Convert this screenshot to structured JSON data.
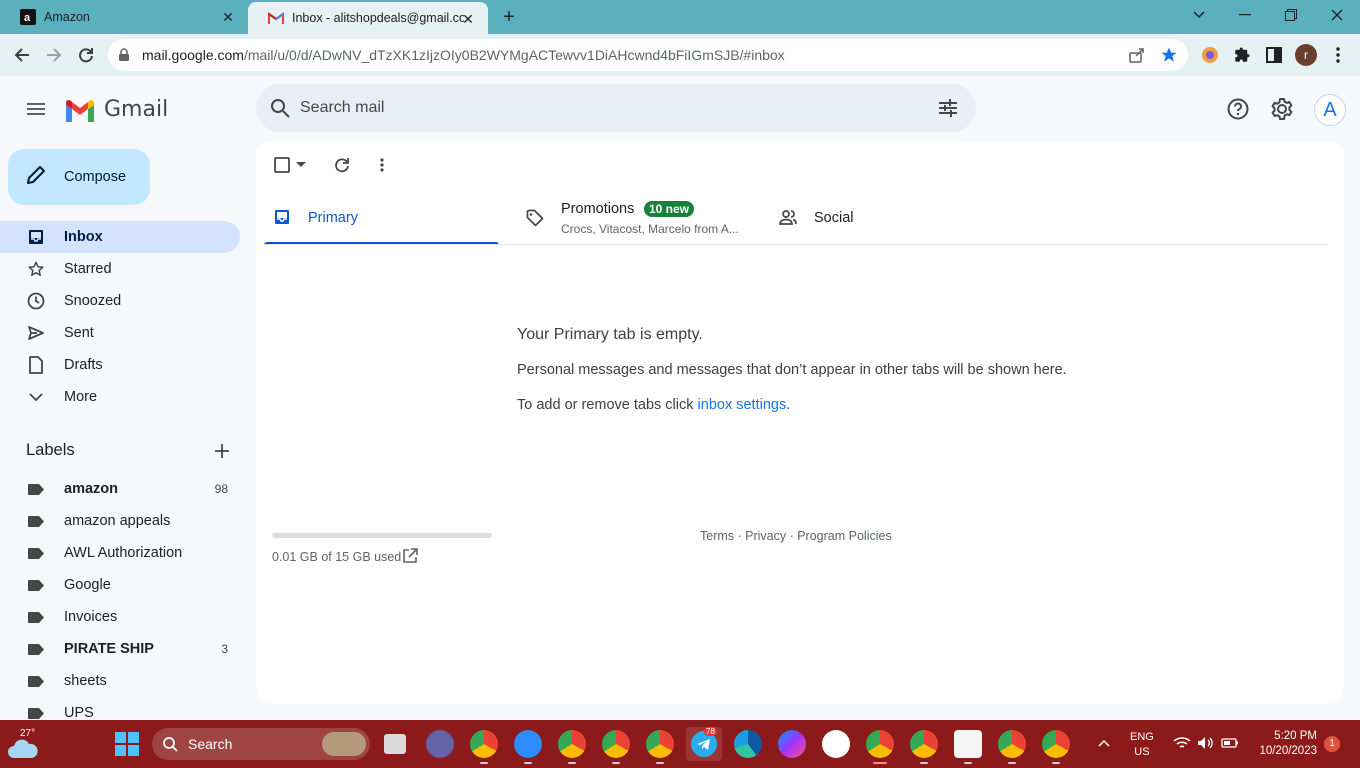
{
  "browser": {
    "tabs": [
      {
        "title": "Amazon",
        "favicon": "amazon-icon"
      },
      {
        "title": "Inbox - alitshopdeals@gmail.com - Gmail",
        "favicon": "gmail-icon"
      }
    ],
    "url_host": "mail.google.com",
    "url_path": "/mail/u/0/d/ADwNV_dTzXK1zIjzOIy0B2WYMgACTewvv1DiAHcwnd4bFiIGmSJB/#inbox",
    "profile_initial": "r"
  },
  "header": {
    "app_name": "Gmail",
    "search_placeholder": "Search mail",
    "account_initial": "A"
  },
  "sidebar": {
    "compose_label": "Compose",
    "items": [
      {
        "label": "Inbox",
        "icon": "inbox-icon",
        "active": true
      },
      {
        "label": "Starred",
        "icon": "star-icon"
      },
      {
        "label": "Snoozed",
        "icon": "clock-icon"
      },
      {
        "label": "Sent",
        "icon": "send-icon"
      },
      {
        "label": "Drafts",
        "icon": "draft-icon"
      },
      {
        "label": "More",
        "icon": "chevron-down-icon"
      }
    ],
    "labels_title": "Labels",
    "labels": [
      {
        "name": "amazon",
        "count": "98",
        "bold": true
      },
      {
        "name": "amazon appeals",
        "count": ""
      },
      {
        "name": "AWL Authorization",
        "count": ""
      },
      {
        "name": "Google",
        "count": ""
      },
      {
        "name": "Invoices",
        "count": ""
      },
      {
        "name": "PIRATE SHIP",
        "count": "3",
        "bold": true
      },
      {
        "name": "sheets",
        "count": ""
      },
      {
        "name": "UPS",
        "count": ""
      }
    ]
  },
  "tabs": {
    "primary": "Primary",
    "promotions": "Promotions",
    "promotions_badge": "10 new",
    "promotions_senders": "Crocs, Vitacost, Marcelo from A...",
    "social": "Social"
  },
  "empty_state": {
    "title": "Your Primary tab is empty.",
    "line1": "Personal messages and messages that don’t appear in other tabs will be shown here.",
    "line2_prefix": "To add or remove tabs click ",
    "line2_link": "inbox settings",
    "line2_suffix": "."
  },
  "footer": {
    "storage": "0.01 GB of 15 GB used",
    "storage_used_fraction": 0.001,
    "links": "Terms · Privacy · Program Policies"
  },
  "taskbar": {
    "temperature": "27°",
    "search_label": "Search",
    "lang_line1": "ENG",
    "lang_line2": "US",
    "time": "5:20 PM",
    "date": "10/20/2023",
    "notifications": "1",
    "telegram_badge": "78"
  }
}
